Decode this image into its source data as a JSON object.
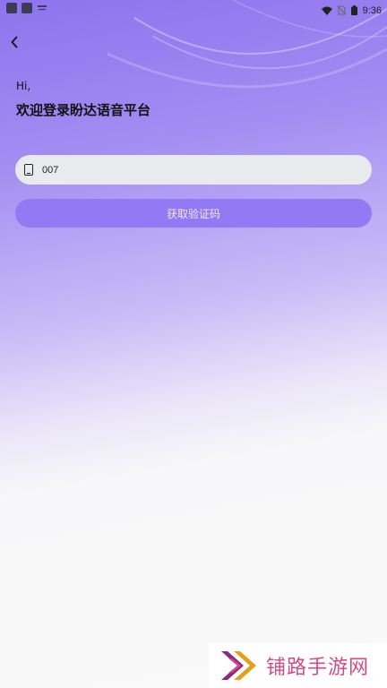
{
  "status_bar": {
    "time": "9:36",
    "icons": [
      "app-icon",
      "app-icon",
      "notification-icon",
      "wifi-icon",
      "no-sim-icon",
      "battery-icon"
    ]
  },
  "nav": {
    "back_icon": "chevron-left-icon"
  },
  "login": {
    "greeting": "Hi,",
    "welcome": "欢迎登录盼达语音平台",
    "phone_value": "007",
    "phone_icon": "phone-icon",
    "get_code_label": "获取验证码"
  },
  "watermark": {
    "text": "铺路手游网"
  },
  "colors": {
    "accent": "#9379f4",
    "field_bg": "#e8eaed",
    "watermark": "#d24b86"
  }
}
